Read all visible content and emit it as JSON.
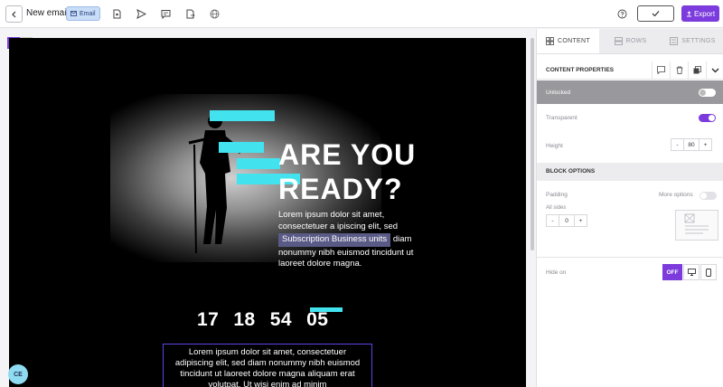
{
  "topbar": {
    "title": "New email",
    "badge": "Email",
    "back_icon": "chevron-left-icon",
    "tools": [
      "document-icon",
      "send-icon",
      "comment-icon",
      "file-export-icon",
      "globe-icon"
    ],
    "help_icon": "help-icon",
    "confirm_icon": "check-icon",
    "export_label": "Export",
    "accent": "#7b3bdd"
  },
  "canvas": {
    "headline_line1": "ARE YOU",
    "headline_line2": "READY?",
    "paragraph_before": "Lorem ipsum dolor sit amet, consectetuer a ipiscing elit, sed",
    "tag": "Subscription Business units",
    "paragraph_after": "diam nonummy nibh euismod tincidunt ut laoreet dolore magna.",
    "countdown": [
      "17",
      "18",
      "54",
      "05"
    ],
    "selected_text": "Lorem ipsum dolor sit amet, consectetuer adipiscing elit, sed diam nonummy nibh euismod tincidunt ut laoreet dolore magna aliquam erat volutpat. Ut wisi enim ad minim",
    "avatar": "CE",
    "cyan": "#42e3ee"
  },
  "panel": {
    "tabs": [
      {
        "label": "CONTENT",
        "icon": "grid-icon"
      },
      {
        "label": "ROWS",
        "icon": "rows-icon"
      },
      {
        "label": "SETTINGS",
        "icon": "settings-icon"
      }
    ],
    "content_properties": "CONTENT PROPERTIES",
    "unlocked": "Unlocked",
    "transparent": "Transparent",
    "height": "Height",
    "height_value": "80",
    "block_options": "BLOCK OPTIONS",
    "padding": "Padding",
    "more_options": "More options",
    "all_sides": "All sides",
    "padding_value": "0",
    "hide_on": "Hide on",
    "off": "OFF",
    "minus": "-",
    "plus": "+"
  }
}
